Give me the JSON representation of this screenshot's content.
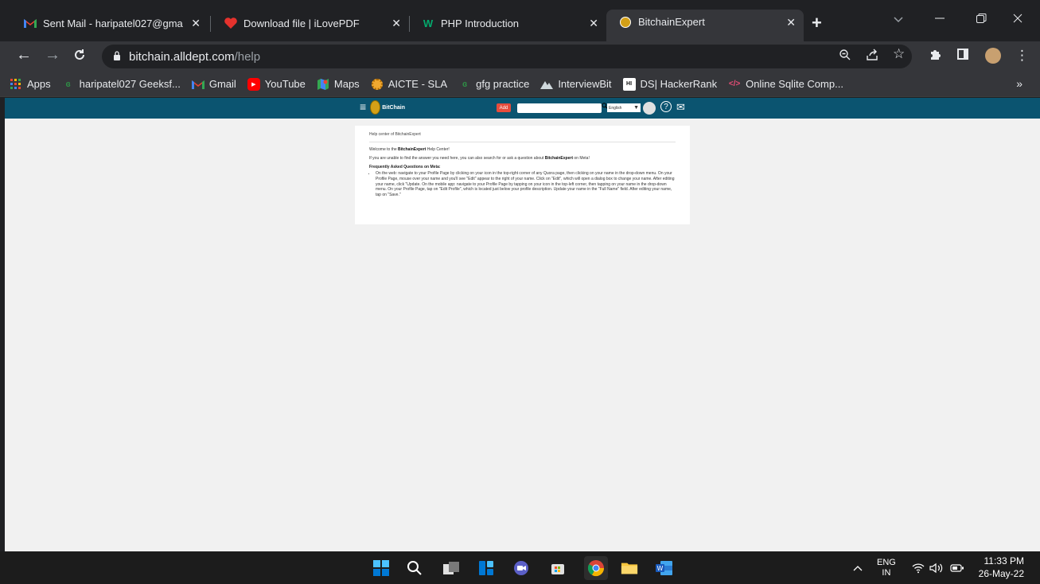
{
  "browser": {
    "tabs": [
      {
        "title": "Sent Mail - haripatel027@gma",
        "icon": "gmail-icon",
        "active": false
      },
      {
        "title": "Download file | iLovePDF",
        "icon": "ilovepdf-icon",
        "active": false
      },
      {
        "title": "PHP Introduction",
        "icon": "w3schools-icon",
        "active": false
      },
      {
        "title": "BitchainExpert",
        "icon": "bitchain-icon",
        "active": true
      }
    ],
    "address": {
      "host": "bitchain.alldept.com",
      "path": "/help"
    },
    "bookmarks": [
      {
        "label": "Apps",
        "icon": "apps-grid-icon"
      },
      {
        "label": "haripatel027 Geeksf...",
        "icon": "geeksforgeeks-icon"
      },
      {
        "label": "Gmail",
        "icon": "gmail-icon"
      },
      {
        "label": "YouTube",
        "icon": "youtube-icon"
      },
      {
        "label": "Maps",
        "icon": "maps-icon"
      },
      {
        "label": "AICTE - SLA",
        "icon": "aicte-icon"
      },
      {
        "label": "gfg practice",
        "icon": "geeksforgeeks-icon"
      },
      {
        "label": "InterviewBit",
        "icon": "interviewbit-icon"
      },
      {
        "label": "DS| HackerRank",
        "icon": "hackerrank-icon"
      },
      {
        "label": "Online Sqlite Comp...",
        "icon": "code-icon"
      }
    ],
    "bookmarks_more": "»",
    "colors": {
      "accent": "#202124",
      "toolbar": "#35363a"
    }
  },
  "site": {
    "logo_text": "BitChain",
    "add_label": "Add",
    "language": "English",
    "header_color": "#0b5470",
    "help": {
      "breadcrumb": "Help center of BitchainExpert",
      "welcome_prefix": "Welcome to the ",
      "welcome_brand": "BitchainExpert",
      "welcome_suffix": " Help Center!",
      "search_prefix": "If you are unable to find the answer you need here, you can also search for or ask a question about ",
      "search_brand": "BitchainExpert",
      "search_suffix": " on Meta!",
      "faq_heading": "Frequently Asked Questions on Meta:",
      "faq_items": [
        "On the web: navigate to your Profile Page by clicking on your icon in the top-right corner of any Quora page, then clicking on your name in the drop-down menu. On your Profile Page, mouse over your name and you'll see \"Edit\" appear to the right of your name. Click on \"Edit\", which will open a dialog box to change your name. After editing your name, click \"Update. On the mobile app: navigate to your Profile Page by tapping on your icon in the top-left corner, then tapping on your name in the drop-down menu. On your Profile Page, tap on \"Edit Profile\", which is located just below your profile description. Update your name in the \"Full Name\" field. After editing your name, tap on \"Save.\""
      ]
    }
  },
  "taskbar": {
    "language": "ENG",
    "region": "IN",
    "time": "11:33 PM",
    "date": "26-May-22"
  }
}
